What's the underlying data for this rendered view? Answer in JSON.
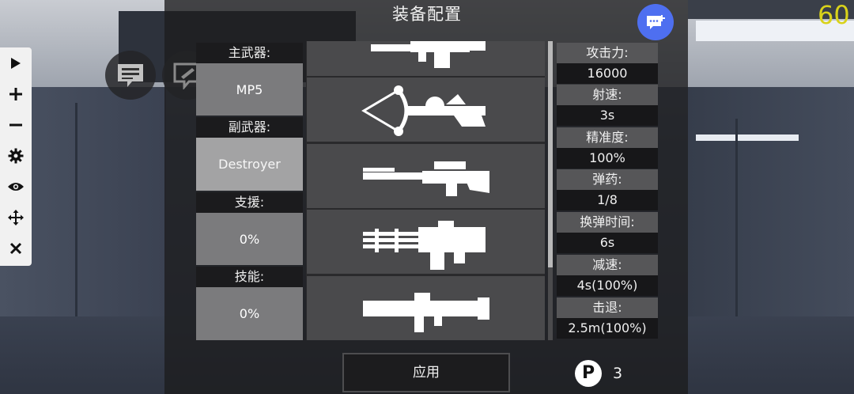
{
  "title": "装备配置",
  "fps": "60",
  "toolbar": {
    "items": [
      "play-icon",
      "plus-icon",
      "minus-icon",
      "gear-icon",
      "eye-icon",
      "move-icon",
      "close-icon"
    ]
  },
  "loadout": {
    "primary_label": "主武器:",
    "primary_value": "MP5",
    "secondary_label": "副武器:",
    "secondary_value": "Destroyer",
    "support_label": "支援:",
    "support_value": "0%",
    "skill_label": "技能:",
    "skill_value": "0%"
  },
  "weapons": [
    "rifle-icon",
    "crossbow-icon",
    "sniper-rifle-icon",
    "minigun-icon",
    "rocket-launcher-icon"
  ],
  "stats": [
    {
      "label": "攻击力:",
      "value": "16000"
    },
    {
      "label": "射速:",
      "value": "3s"
    },
    {
      "label": "精准度:",
      "value": "100%"
    },
    {
      "label": "弹药:",
      "value": "1/8"
    },
    {
      "label": "换弹时间:",
      "value": "6s"
    },
    {
      "label": "减速:",
      "value": "4s(100%)"
    },
    {
      "label": "击退:",
      "value": "2.5m(100%)"
    }
  ],
  "apply_label": "应用",
  "points": {
    "icon_letter": "P",
    "value": "3"
  },
  "colors": {
    "accent": "#4e6ff0",
    "fps": "#d9d21a",
    "selected_slot": "#a3a3a4"
  }
}
